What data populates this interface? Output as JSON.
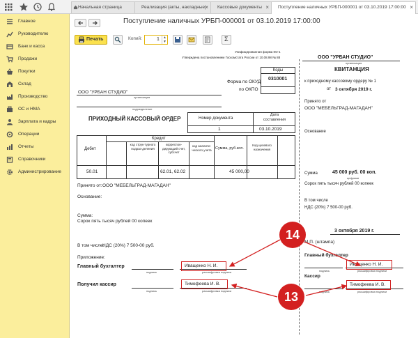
{
  "toolbar_icons": [
    "grid-icon",
    "star-icon",
    "history-icon",
    "bell-icon"
  ],
  "tabs": [
    {
      "label": "Начальная страница",
      "active": false,
      "closable": false
    },
    {
      "label": "Реализация (акты, накладные)",
      "active": false,
      "closable": true
    },
    {
      "label": "Кассовые документы",
      "active": false,
      "closable": true
    },
    {
      "label": "Поступление наличных УРБП-000001 от 03.10.2019 17:00:00",
      "active": true,
      "closable": true
    }
  ],
  "sidebar": {
    "items": [
      {
        "label": "Главное",
        "icon": "menu-icon"
      },
      {
        "label": "Руководителю",
        "icon": "chart-icon"
      },
      {
        "label": "Банк и касса",
        "icon": "bank-icon"
      },
      {
        "label": "Продажи",
        "icon": "cart-icon"
      },
      {
        "label": "Покупки",
        "icon": "basket-icon"
      },
      {
        "label": "Склад",
        "icon": "warehouse-icon"
      },
      {
        "label": "Производство",
        "icon": "factory-icon"
      },
      {
        "label": "ОС и НМА",
        "icon": "assets-icon"
      },
      {
        "label": "Зарплата и кадры",
        "icon": "people-icon"
      },
      {
        "label": "Операции",
        "icon": "operations-icon"
      },
      {
        "label": "Отчеты",
        "icon": "reports-icon"
      },
      {
        "label": "Справочники",
        "icon": "book-icon"
      },
      {
        "label": "Администрирование",
        "icon": "gear-icon"
      }
    ]
  },
  "header": {
    "title": "Поступление наличных УРБП-000001 от 03.10.2019 17:00:00",
    "back_icon": "arrow-left-icon",
    "forward_icon": "arrow-right-icon"
  },
  "print_toolbar": {
    "print_label": "Печать",
    "copies_label": "Копий:",
    "copies_value": "1"
  },
  "order": {
    "unified_form": "Унифицированная форма КО-1",
    "approved": "Утверждена постановлением Госкомстата России от 10.08.98 № 88",
    "codes_header": "Коды",
    "okud_label": "Форма по ОКУД",
    "okpo_label": "по ОКПО",
    "okud_value": "0310001",
    "organization": "ООО \"УРБАН СТУДИО\"",
    "organization_caption": "организация",
    "subdivision_caption": "подразделение",
    "title": "ПРИХОДНЫЙ КАССОВЫЙ ОРДЕР",
    "doc_number_header": "Номер документа",
    "doc_date_header": "Дата составления",
    "doc_number": "1",
    "doc_date": "03.10.2019",
    "table": {
      "debit": "Дебет",
      "credit": "Кредит",
      "struct_code": "код струк-турного подраз-деления",
      "corr_account": "корреспон-дирующий счет, субсчет",
      "analytics_code": "код аналити-ческого учета",
      "sum_header": "Сумма, руб.коп.",
      "purpose_code": "Код целевого назначения",
      "debit_value": "50.01",
      "corr_value": "62.01, 62.02",
      "sum_value": "45 000,00"
    },
    "received_from_label": "Принято от:",
    "received_from": "ООО \"МЕБЕЛЬГРАД-МАГАДАН\"",
    "basis_label": "Основание:",
    "sum_label": "Сумма:",
    "sum_words": "Сорок пять тысяч рублей 00 копеек",
    "including_label": "В том числе:",
    "vat_text": "НДС (20%) 7 500-00 руб.",
    "attachment_label": "Приложение:",
    "chief_accountant_label": "Главный бухгалтер",
    "cashier_label": "Получил кассир",
    "signature_caption": "подпись",
    "decoding_caption": "расшифровка подписи",
    "chief_name": "Иващенко Н. И.",
    "cashier_name": "Тимофеева И. В."
  },
  "receipt": {
    "organization": "ООО \"УРБАН СТУДИО\"",
    "organization_caption": "организация",
    "title": "КВИТАНЦИЯ",
    "to_order": "к приходному кассовому ордеру № 1",
    "from_label": "от",
    "date": "3 октября 2019 г.",
    "received_from_label": "Принято от",
    "received_from": "ООО \"МЕБЕЛЬГРАД-МАГАДАН\"",
    "basis_label": "Основание",
    "sum_label": "Сумма",
    "sum_value": "45 000 руб. 00 коп.",
    "digits_caption": "цифрами",
    "sum_words": "Сорок пять тысяч рублей 00 копеек",
    "including_label": "В том числе",
    "vat_text": "НДС (20%) 7 500-00 руб.",
    "date2": "3 октября 2019 г.",
    "stamp_label": "М.П. (штампа)",
    "chief_accountant_label": "Главный бухгалтер",
    "cashier_label": "Кассир",
    "signature_caption": "подпись",
    "decoding_caption": "расшифровка подписи",
    "chief_name": "Иващенко Н. И.",
    "cashier_name": "Тимофеева И. В."
  },
  "annotations": {
    "marker_top": "14",
    "marker_bottom": "13",
    "color": "#d32020"
  },
  "colors": {
    "sidebar_bg": "#fbee9c",
    "print_button": "#fbe14d",
    "highlight": "#d02020"
  }
}
